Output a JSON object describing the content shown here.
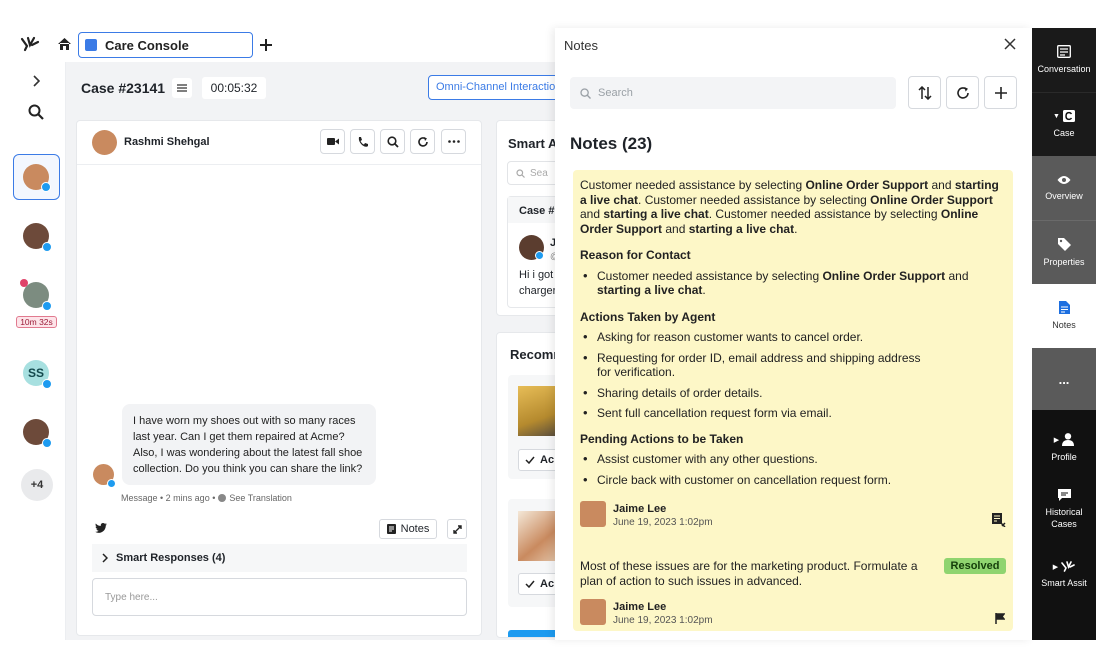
{
  "topbar": {
    "tab_label": "Care Console"
  },
  "left_rail": {
    "timer_badge": "10m 32s",
    "initials_avatar": "SS",
    "more_count": "+4"
  },
  "case": {
    "title": "Case #23141",
    "timer": "00:05:32",
    "omni_button": "Omni-Channel Interactio"
  },
  "conversation": {
    "contact_name": "Rashmi Shehgal",
    "message": "I have worn my shoes out with so many races last year. Can I get them repaired at Acme? Also, I was wondering about the latest fall shoe collection. Do you think you can share the link?",
    "message_meta": "Message • 2 mins ago •",
    "see_translation": "See Translation",
    "notes_button": "Notes",
    "smart_responses": "Smart Responses (4)",
    "reply_placeholder": "Type here..."
  },
  "smart_assist": {
    "title": "Smart A",
    "search_placeholder": "Sea",
    "case_label": "Case #",
    "initial": "J",
    "initial_sub": "@",
    "snippet_1": "Hi i got",
    "snippet_2": "charger",
    "recommended": "Recomm",
    "rec_action_1": "Ac",
    "rec_action_2": "Ac"
  },
  "notes_panel": {
    "header": "Notes",
    "search_placeholder": "Search",
    "title": "Notes (23)",
    "note1": {
      "intro": [
        {
          "t": "Customer needed assistance by selecting ",
          "b": false
        },
        {
          "t": "Online Order Support",
          "b": true
        },
        {
          "t": " and ",
          "b": false
        },
        {
          "t": "starting a live chat",
          "b": true
        },
        {
          "t": ". Customer needed assistance by selecting ",
          "b": false
        },
        {
          "t": "Online Order Support",
          "b": true
        },
        {
          "t": " and ",
          "b": false
        },
        {
          "t": "starting a live chat",
          "b": true
        },
        {
          "t": ". Customer needed assistance by selecting ",
          "b": false
        },
        {
          "t": "Online Order Support",
          "b": true
        },
        {
          "t": " and ",
          "b": false
        },
        {
          "t": "starting a live chat",
          "b": true
        },
        {
          "t": ".",
          "b": false
        }
      ],
      "reason_heading": "Reason for Contact",
      "reason_item": [
        {
          "t": "Customer needed assistance by selecting ",
          "b": false
        },
        {
          "t": "Online Order Support",
          "b": true
        },
        {
          "t": " and ",
          "b": false
        },
        {
          "t": "starting a live chat",
          "b": true
        },
        {
          "t": ".",
          "b": false
        }
      ],
      "actions_heading": "Actions Taken by Agent",
      "actions": [
        "Asking for reason customer wants to cancel order.",
        "Requesting for order ID, email address and shipping address for verification.",
        "Sharing details of order details.",
        "Sent full cancellation request form via email."
      ],
      "pending_heading": "Pending Actions to be Taken",
      "pending": [
        "Assist customer with any other questions.",
        "Circle back with customer on cancellation request form."
      ],
      "author": "Jaime Lee",
      "date": "June 19, 2023 1:02pm"
    },
    "note2": {
      "text": "Most of these issues are for the marketing product. Formulate a plan of action to such issues in advanced.",
      "status": "Resolved",
      "author": "Jaime Lee",
      "date": "June 19, 2023 1:02pm"
    }
  },
  "right_nav": {
    "conversation": "Conversation",
    "case": "Case",
    "overview": "Overview",
    "properties": "Properties",
    "notes": "Notes",
    "more": "...",
    "profile": "Profile",
    "historical_cases": "Historical Cases",
    "smart_assist": "Smart Assit"
  },
  "colors": {
    "accent": "#3b7be6",
    "note_bg": "#fdf7c7",
    "resolved": "#8fd46f",
    "rail_dark": "#111111"
  }
}
